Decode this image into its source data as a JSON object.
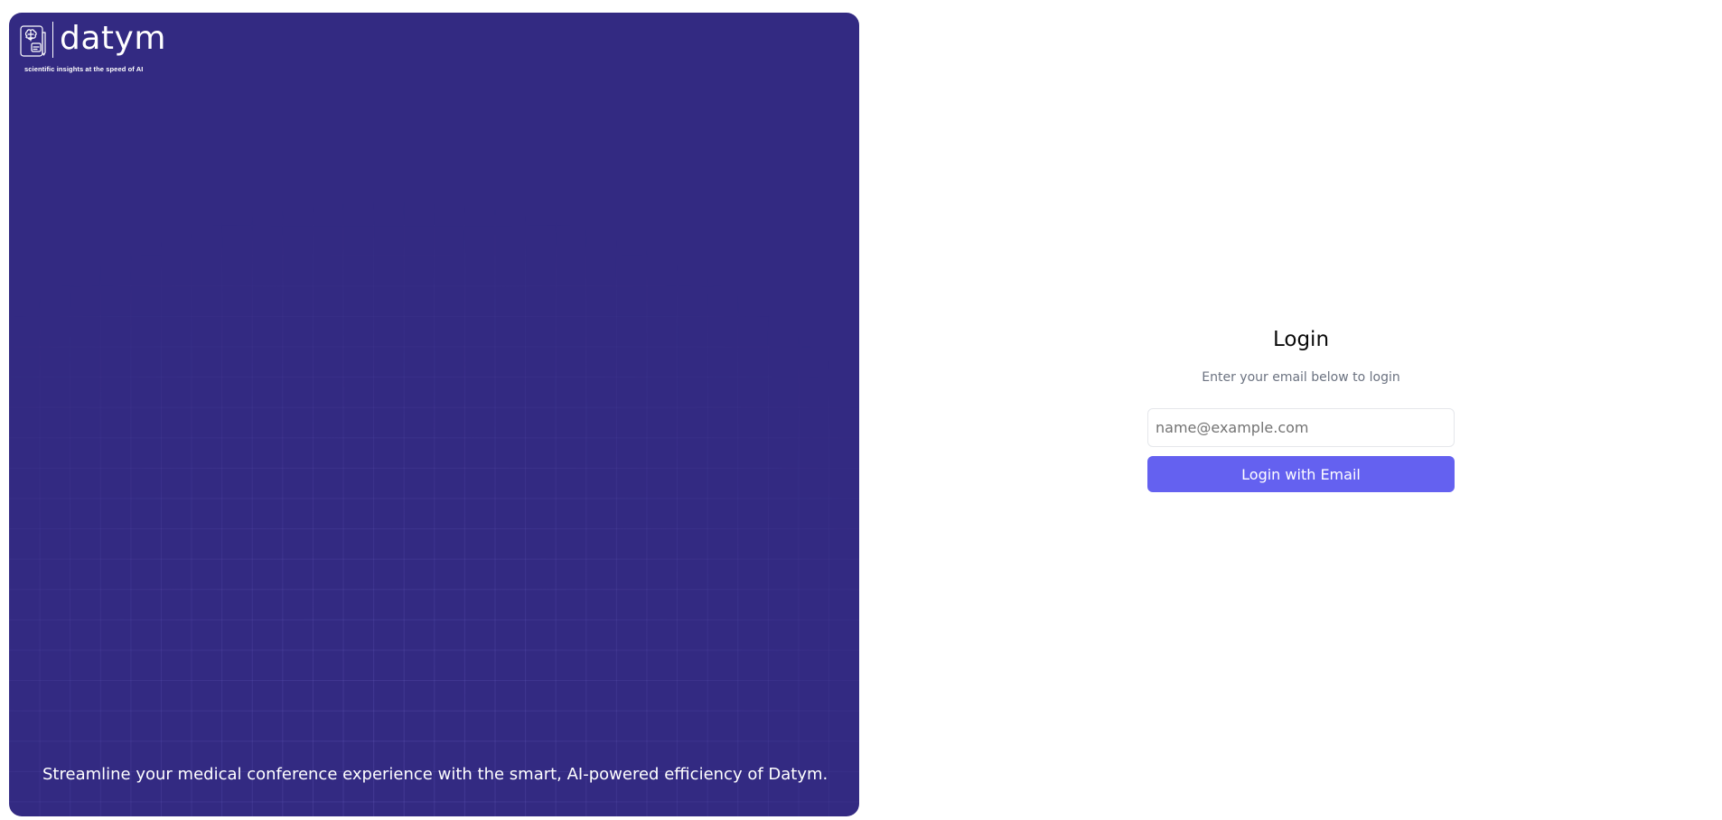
{
  "brand": {
    "name": "datym",
    "tagline": "scientific insights at the speed of AI",
    "logo_icon": "brain-document-icon",
    "quote": "Streamline your medical conference experience with the smart, AI-powered efficiency of Datym.",
    "panel_color": "#332a82"
  },
  "login": {
    "title": "Login",
    "subtitle": "Enter your email below to login",
    "email_placeholder": "name@example.com",
    "email_value": "",
    "submit_label": "Login with Email",
    "accent_color": "#6461f0"
  }
}
